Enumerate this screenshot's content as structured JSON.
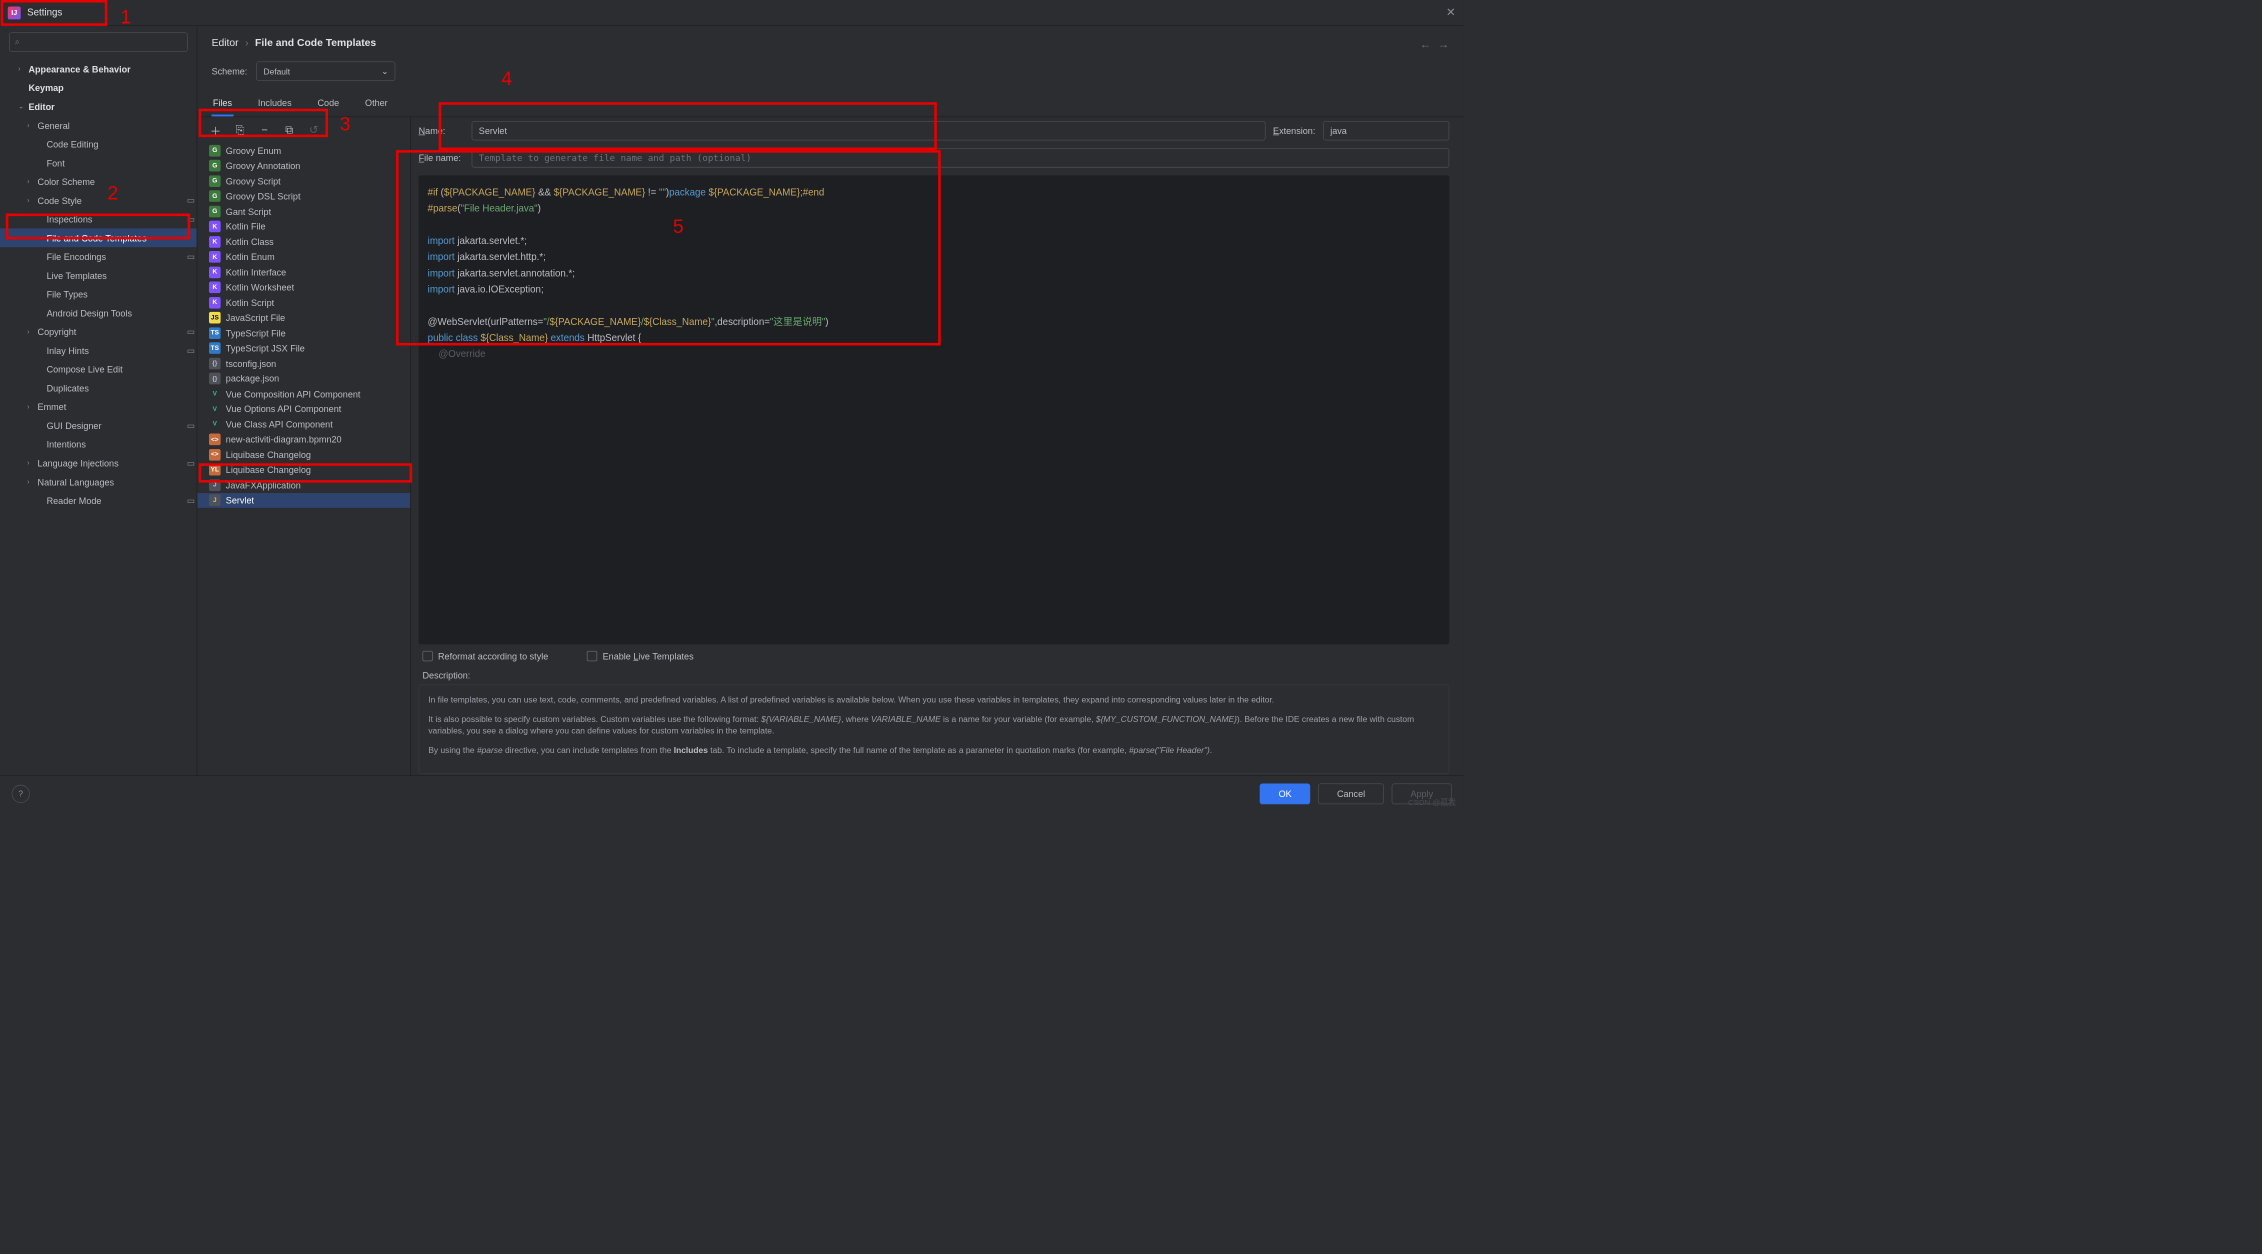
{
  "window": {
    "title": "Settings"
  },
  "search": {
    "placeholder": ""
  },
  "sidebar": {
    "items": [
      {
        "label": "Appearance & Behavior",
        "level": "l1",
        "chev": "›",
        "bold": true
      },
      {
        "label": "Keymap",
        "level": "l1",
        "chev": "",
        "bold": true
      },
      {
        "label": "Editor",
        "level": "l1",
        "chev": "⌄",
        "bold": true
      },
      {
        "label": "General",
        "level": "l2b",
        "chev": "›"
      },
      {
        "label": "Code Editing",
        "level": "l2",
        "chev": ""
      },
      {
        "label": "Font",
        "level": "l2",
        "chev": ""
      },
      {
        "label": "Color Scheme",
        "level": "l2b",
        "chev": "›"
      },
      {
        "label": "Code Style",
        "level": "l2b",
        "chev": "›",
        "mod": true
      },
      {
        "label": "Inspections",
        "level": "l2",
        "chev": "",
        "mod": true
      },
      {
        "label": "File and Code Templates",
        "level": "l2",
        "chev": "",
        "selected": true
      },
      {
        "label": "File Encodings",
        "level": "l2",
        "chev": "",
        "mod": true
      },
      {
        "label": "Live Templates",
        "level": "l2",
        "chev": ""
      },
      {
        "label": "File Types",
        "level": "l2",
        "chev": ""
      },
      {
        "label": "Android Design Tools",
        "level": "l2",
        "chev": ""
      },
      {
        "label": "Copyright",
        "level": "l2b",
        "chev": "›",
        "mod": true
      },
      {
        "label": "Inlay Hints",
        "level": "l2",
        "chev": "",
        "mod": true
      },
      {
        "label": "Compose Live Edit",
        "level": "l2",
        "chev": ""
      },
      {
        "label": "Duplicates",
        "level": "l2",
        "chev": ""
      },
      {
        "label": "Emmet",
        "level": "l2b",
        "chev": "›"
      },
      {
        "label": "GUI Designer",
        "level": "l2",
        "chev": "",
        "mod": true
      },
      {
        "label": "Intentions",
        "level": "l2",
        "chev": ""
      },
      {
        "label": "Language Injections",
        "level": "l2b",
        "chev": "›",
        "mod": true
      },
      {
        "label": "Natural Languages",
        "level": "l2b",
        "chev": "›"
      },
      {
        "label": "Reader Mode",
        "level": "l2",
        "chev": "",
        "mod": true
      }
    ]
  },
  "breadcrumb": {
    "a": "Editor",
    "b": "File and Code Templates"
  },
  "scheme": {
    "label": "Scheme:",
    "value": "Default"
  },
  "tabs": [
    {
      "label": "Files",
      "active": true
    },
    {
      "label": "Includes"
    },
    {
      "label": "Code"
    },
    {
      "label": "Other"
    }
  ],
  "templates": [
    {
      "label": "Groovy Enum",
      "ic": "ic-g",
      "ch": "G"
    },
    {
      "label": "Groovy Annotation",
      "ic": "ic-g",
      "ch": "G"
    },
    {
      "label": "Groovy Script",
      "ic": "ic-g",
      "ch": "G"
    },
    {
      "label": "Groovy DSL Script",
      "ic": "ic-g",
      "ch": "G"
    },
    {
      "label": "Gant Script",
      "ic": "ic-g",
      "ch": "G"
    },
    {
      "label": "Kotlin File",
      "ic": "ic-k",
      "ch": "K"
    },
    {
      "label": "Kotlin Class",
      "ic": "ic-k",
      "ch": "K"
    },
    {
      "label": "Kotlin Enum",
      "ic": "ic-k",
      "ch": "K"
    },
    {
      "label": "Kotlin Interface",
      "ic": "ic-k",
      "ch": "K"
    },
    {
      "label": "Kotlin Worksheet",
      "ic": "ic-k",
      "ch": "K"
    },
    {
      "label": "Kotlin Script",
      "ic": "ic-k",
      "ch": "K"
    },
    {
      "label": "JavaScript File",
      "ic": "ic-js",
      "ch": "JS"
    },
    {
      "label": "TypeScript File",
      "ic": "ic-ts",
      "ch": "TS"
    },
    {
      "label": "TypeScript JSX File",
      "ic": "ic-ts",
      "ch": "TS"
    },
    {
      "label": "tsconfig.json",
      "ic": "ic-file",
      "ch": "{}"
    },
    {
      "label": "package.json",
      "ic": "ic-file",
      "ch": "{}"
    },
    {
      "label": "Vue Composition API Component",
      "ic": "ic-vue",
      "ch": "V"
    },
    {
      "label": "Vue Options API Component",
      "ic": "ic-vue",
      "ch": "V"
    },
    {
      "label": "Vue Class API Component",
      "ic": "ic-vue",
      "ch": "V"
    },
    {
      "label": "new-activiti-diagram.bpmn20",
      "ic": "ic-xml",
      "ch": "<>"
    },
    {
      "label": "Liquibase Changelog",
      "ic": "ic-xml",
      "ch": "<>"
    },
    {
      "label": "Liquibase Changelog",
      "ic": "ic-xml",
      "ch": "YL"
    },
    {
      "label": "JavaFXApplication",
      "ic": "ic-file",
      "ch": "J"
    },
    {
      "label": "Servlet",
      "ic": "ic-file",
      "ch": "J",
      "selected": true
    }
  ],
  "fields": {
    "nameLabel": "ame:",
    "nameLabelU": "N",
    "nameValue": "Servlet",
    "extLabel": "xtension:",
    "extLabelU": "E",
    "extValue": "java",
    "fileLabel": "ile name:",
    "fileLabelU": "F",
    "filePlaceholder": "Template to generate file name and path (optional)"
  },
  "code": {
    "l1a": "#if",
    "l1b": " (",
    "l1c": "${PACKAGE_NAME}",
    "l1d": " && ",
    "l1e": "${PACKAGE_NAME}",
    "l1f": " != ",
    "l1g": "\"\"",
    "l1h": ")",
    "l1i": "package ",
    "l1j": "${PACKAGE_NAME}",
    "l1k": ";",
    "l1l": "#end",
    "l2a": "#parse",
    "l2b": "(",
    "l2c": "\"File Header.java\"",
    "l2d": ")",
    "l4": "import",
    "l4b": " jakarta.servlet.*;",
    "l5": "import",
    "l5b": " jakarta.servlet.http.*;",
    "l6": "import",
    "l6b": " jakarta.servlet.annotation.*;",
    "l7": "import",
    "l7b": " java.io.IOException;",
    "l9a": "@WebServlet(urlPatterns=",
    "l9b": "\"/",
    "l9c": "${PACKAGE_NAME}",
    "l9d": "/",
    "l9e": "${Class_Name}",
    "l9f": "\"",
    "l9g": ",description=",
    "l9h": "\"这里是说明\"",
    "l9i": ")",
    "l10a": "public class ",
    "l10b": "${Class_Name}",
    "l10c": " extends ",
    "l10d": "HttpServlet {",
    "l11": "    @Override"
  },
  "checks": {
    "reformat": "Reformat according to style",
    "live": "Enable Live Templates",
    "liveU": "L"
  },
  "desc": {
    "label": "Description:",
    "p1": "In file templates, you can use text, code, comments, and predefined variables. A list of predefined variables is available below. When you use these variables in templates, they expand into corresponding values later in the editor.",
    "p2a": "It is also possible to specify custom variables. Custom variables use the following format: ",
    "p2b": "${VARIABLE_NAME}",
    "p2c": ", where ",
    "p2d": "VARIABLE_NAME",
    "p2e": " is a name for your variable (for example, ",
    "p2f": "${MY_CUSTOM_FUNCTION_NAME}",
    "p2g": "). Before the IDE creates a new file with custom variables, you see a dialog where you can define values for custom variables in the template.",
    "p3a": "By using the ",
    "p3b": "#parse",
    "p3c": " directive, you can include templates from the ",
    "p3d": "Includes",
    "p3e": " tab. To include a template, specify the full name of the template as a parameter in quotation marks (for example, ",
    "p3f": "#parse(\"File Header\")",
    "p3g": "."
  },
  "buttons": {
    "ok": "OK",
    "cancel": "Cancel",
    "apply": "Apply"
  },
  "annotations": {
    "a1": "1",
    "a2": "2",
    "a3": "3",
    "a4": "4",
    "a5": "5"
  },
  "watermark": "CSDN @孤我"
}
